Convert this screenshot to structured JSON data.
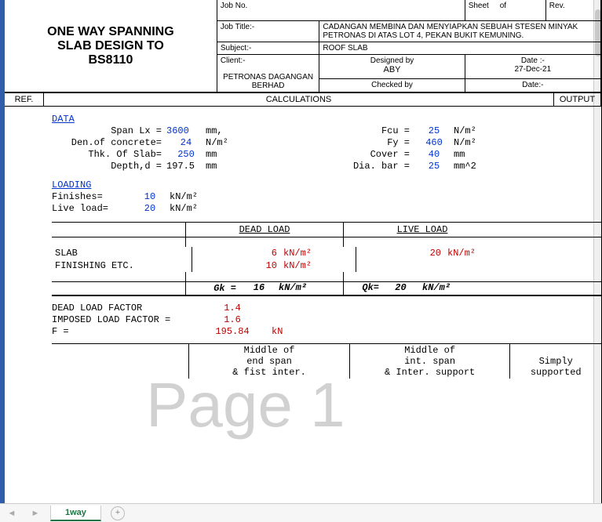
{
  "title_block": {
    "main_title_l1": "ONE WAY SPANNING",
    "main_title_l2": "SLAB DESIGN TO",
    "main_title_l3": "BS8110",
    "job_no_label": "Job No.",
    "sheet_label": "Sheet",
    "of_label": "of",
    "rev_label": "Rev.",
    "job_title_label": "Job Title:-",
    "job_title_value": "CADANGAN MEMBINA DAN MENYIAPKAN SEBUAH STESEN MINYAK PETRONAS DI ATAS LOT 4, PEKAN BUKIT KEMUNING.",
    "subject_label": "Subject:-",
    "subject_value": "ROOF SLAB",
    "client_label": "Client:-",
    "client_value": "PETRONAS DAGANGAN BERHAD",
    "designed_by_label": "Designed by",
    "designed_by_value": "ABY",
    "date_label": "Date :-",
    "date_value": "27-Dec-21",
    "checked_by_label": "Checked by",
    "date2_label": "Date:-"
  },
  "columns": {
    "ref": "REF.",
    "calc": "CALCULATIONS",
    "output": "OUTPUT"
  },
  "data_section": {
    "heading": "DATA",
    "span_label": "Span Lx =",
    "span_val": "3600",
    "span_unit": "mm,",
    "den_label": "Den.of concrete=",
    "den_val": "24",
    "den_unit": "N/m²",
    "thk_label": "Thk. Of Slab=",
    "thk_val": "250",
    "thk_unit": "mm",
    "depth_label": "Depth,d =",
    "depth_val": "197.5",
    "depth_unit": "mm",
    "fcu_label": "Fcu =",
    "fcu_val": "25",
    "fcu_unit": "N/m²",
    "fy_label": "Fy  =",
    "fy_val": "460",
    "fy_unit": "N/m²",
    "cover_label": "Cover  =",
    "cover_val": "40",
    "cover_unit": "mm",
    "dia_label": "Dia. bar =",
    "dia_val": "25",
    "dia_unit": "mm^2"
  },
  "loading_section": {
    "heading": "LOADING",
    "finishes_label": "Finishes=",
    "finishes_val": "10",
    "finishes_unit": "kN/m²",
    "live_label": "Live load=",
    "live_val": "20",
    "live_unit": "kN/m²"
  },
  "load_table": {
    "dead_hdr": "DEAD LOAD",
    "live_hdr": "LIVE LOAD",
    "slab_label": "SLAB",
    "slab_dead": "6",
    "slab_dead_unit": "kN/m²",
    "slab_live": "20",
    "slab_live_unit": "kN/m²",
    "fin_label": "FINISHING ETC.",
    "fin_dead": "10",
    "fin_dead_unit": "kN/m²",
    "gk_label": "Gk =",
    "gk_val": "16",
    "gk_unit": "kN/m²",
    "qk_label": "Qk=",
    "qk_val": "20",
    "qk_unit": "kN/m²"
  },
  "factors": {
    "dead_factor_label": "DEAD LOAD FACTOR",
    "dead_factor_val": "1.4",
    "imp_factor_label": "IMPOSED LOAD FACTOR  =",
    "imp_factor_val": "1.6",
    "F_label": "F  =",
    "F_val": "195.84",
    "F_unit": "kN"
  },
  "bands": {
    "c2_l1": "Middle of",
    "c2_l2": "end span",
    "c2_l3": "& fist inter.",
    "c3_l1": "Middle of",
    "c3_l2": "int. span",
    "c3_l3": "& Inter. support",
    "c4_l1": "Simply",
    "c4_l2": "supported"
  },
  "watermark": "Page 1",
  "tabs": {
    "sheet1": "1way",
    "add_label": "+"
  }
}
